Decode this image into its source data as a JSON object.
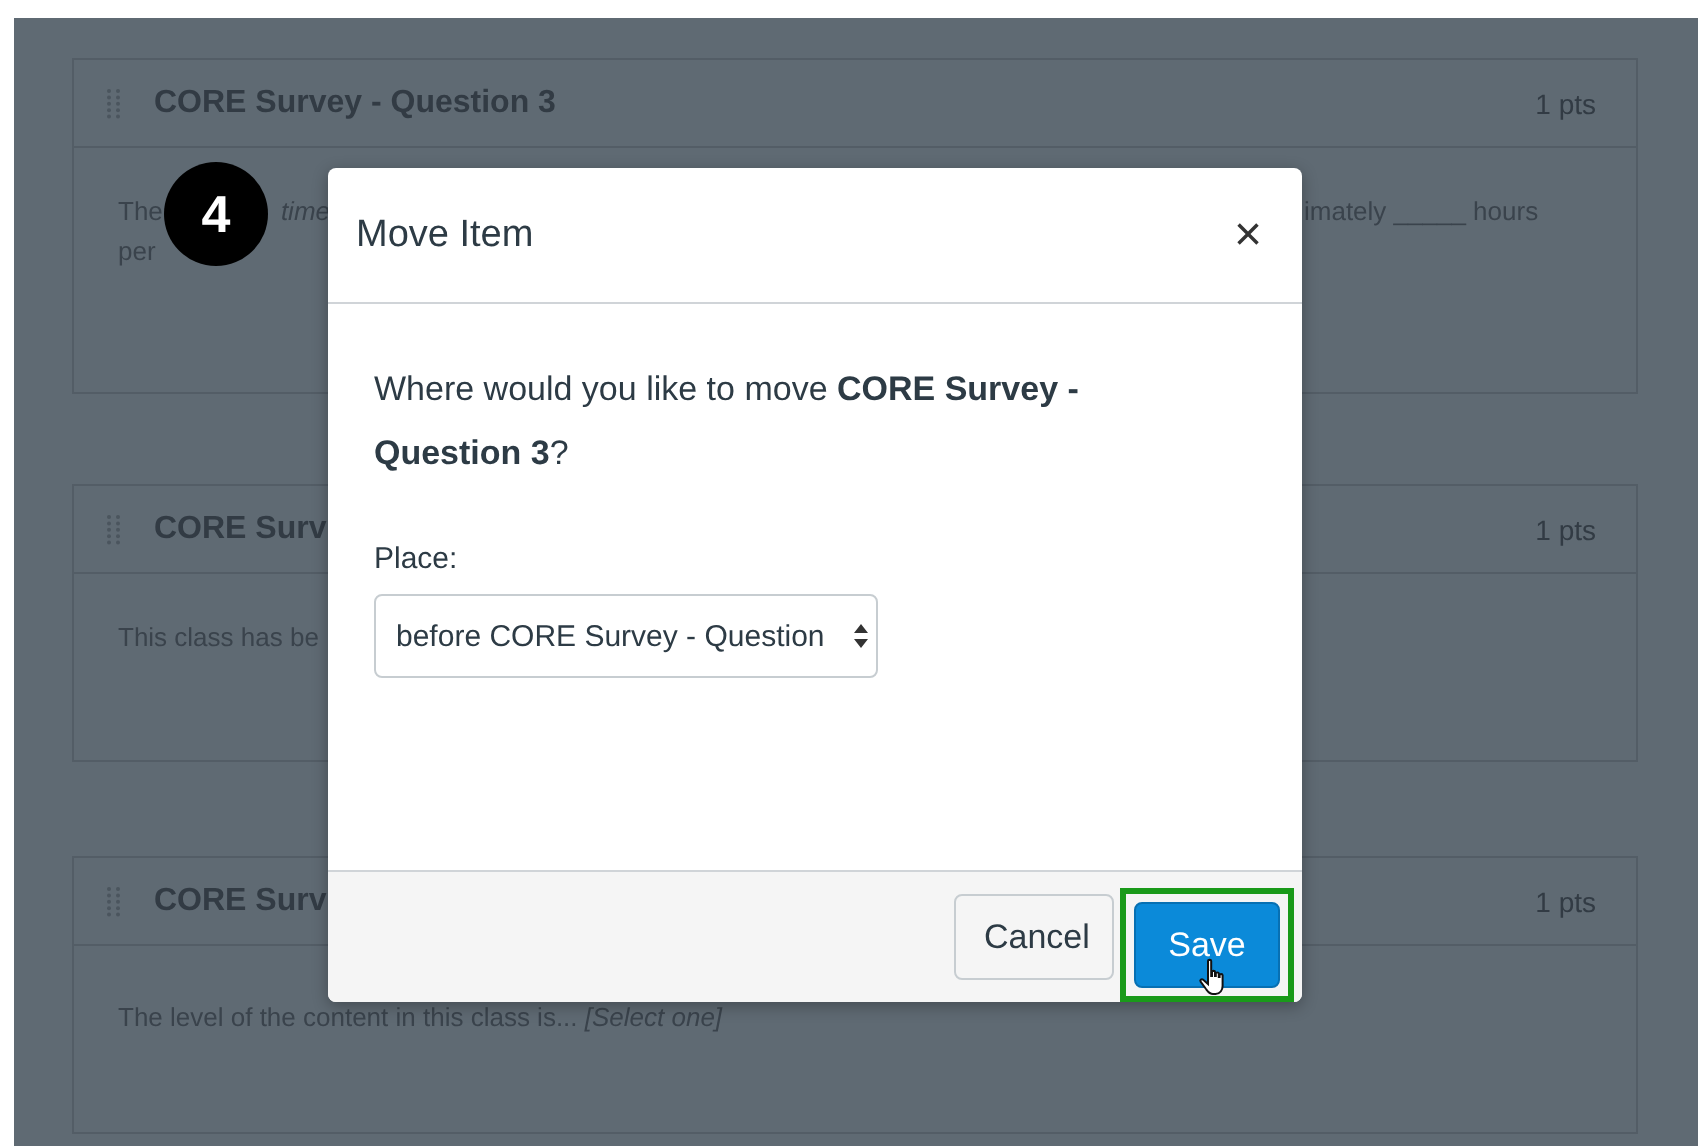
{
  "cards": [
    {
      "title": "CORE Survey - Question 3",
      "points": "1 pts",
      "body_left": [
        [
          "The",
          "*time*"
        ],
        [
          "per"
        ]
      ],
      "body_right": [
        "imately _____ hours"
      ]
    },
    {
      "title": "CORE Surv",
      "points": "1 pts",
      "body_left": [
        [
          "This class has be"
        ]
      ]
    },
    {
      "title": "CORE Surv",
      "points": "1 pts",
      "body_full": "The level of the content in this class is... *[Select one]*"
    }
  ],
  "step_badge": "4",
  "dialog": {
    "title": "Move Item",
    "close": "×",
    "question": "Where would you like to move **CORE Survey - Question 3**?",
    "place_label": "Place:",
    "place_value": "before CORE Survey - Question",
    "buttons": [
      {
        "label": "Cancel",
        "kind": "secondary",
        "highlighted": false,
        "hovered": false
      },
      {
        "label": "Save",
        "kind": "primary",
        "highlighted": true,
        "hovered": true
      }
    ]
  }
}
